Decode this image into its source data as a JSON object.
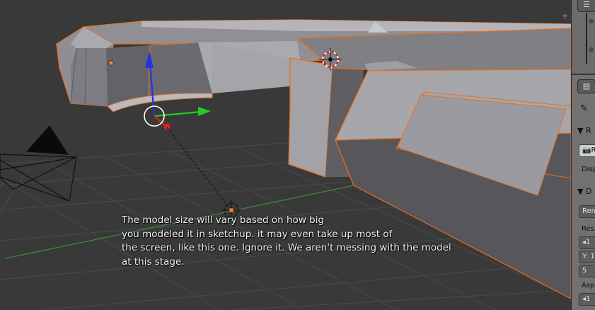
{
  "viewport": {
    "caption_lines": [
      "The model size will vary based on how big",
      "you modeled it in sketchup. it may even take up most of",
      "the screen, like this one. Ignore it. We aren't messing with the model",
      "at this stage."
    ],
    "corner_plus": "+",
    "colors": {
      "background": "#393939",
      "grid": "#4a4a4a",
      "x_axis": "#3e8a3e",
      "selection_outline": "#e8701c",
      "mesh_light": "#9b9b9b",
      "mesh_dark": "#6a6a6a",
      "manipulator_z": "#2233dd",
      "manipulator_y": "#22cc22",
      "manipulator_x": "#dd2222"
    }
  },
  "properties_panel": {
    "outliner_button_icon": "outliner-editor-icon",
    "properties_button_icon": "properties-editor-icon",
    "pin_icon": "pin-icon",
    "sections": {
      "render": {
        "collapse_icon": "triangle-down-icon",
        "label": "R",
        "button_label": "R",
        "display_label": "Disp"
      },
      "dimensions": {
        "collapse_icon": "triangle-down-icon",
        "label": "D",
        "preset_label": "Ren",
        "resolution_label": "Res",
        "res_x": "1",
        "res_y": "Y: 1",
        "res_pct": "5",
        "aspect_label": "Asp",
        "aspect_x": "1"
      }
    }
  }
}
